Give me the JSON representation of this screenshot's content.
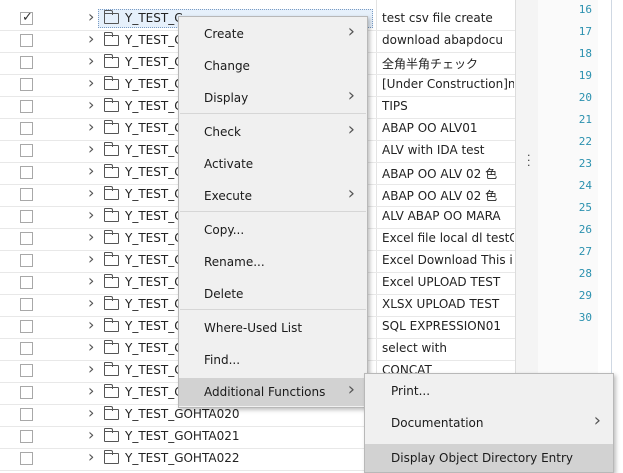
{
  "tree": {
    "rows": [
      {
        "name": "Y_TEST_C",
        "desc": "test csv file create",
        "checked": true
      },
      {
        "name": "Y_TEST_C",
        "desc": "download abapdocu",
        "checked": false
      },
      {
        "name": "Y_TEST_C",
        "desc": "全角半角チェック",
        "checked": false
      },
      {
        "name": "Y_TEST_C",
        "desc": "[Under Construction]n",
        "checked": false
      },
      {
        "name": "Y_TEST_C",
        "desc": "TIPS",
        "checked": false
      },
      {
        "name": "Y_TEST_C",
        "desc": "ABAP OO ALV01",
        "checked": false
      },
      {
        "name": "Y_TEST_C",
        "desc": "ALV with IDA test",
        "checked": false
      },
      {
        "name": "Y_TEST_C",
        "desc": "ABAP OO ALV 02 色",
        "checked": false
      },
      {
        "name": "Y_TEST_C",
        "desc": "ABAP OO ALV 02 色",
        "checked": false
      },
      {
        "name": "Y_TEST_C",
        "desc": "ALV ABAP OO MARA",
        "checked": false
      },
      {
        "name": "Y_TEST_C",
        "desc": "Excel file local dl testC",
        "checked": false
      },
      {
        "name": "Y_TEST_C",
        "desc": "Excel Download  This i",
        "checked": false
      },
      {
        "name": "Y_TEST_C",
        "desc": "Excel UPLOAD TEST",
        "checked": false
      },
      {
        "name": "Y_TEST_C",
        "desc": "XLSX UPLOAD TEST",
        "checked": false
      },
      {
        "name": "Y_TEST_C",
        "desc": "SQL EXPRESSION01",
        "checked": false
      },
      {
        "name": "Y_TEST_C",
        "desc": "select with",
        "checked": false
      },
      {
        "name": "Y_TEST_C",
        "desc": "CONCAT",
        "checked": false
      },
      {
        "name": "Y_TEST_C",
        "desc": "",
        "checked": false
      },
      {
        "name": "Y_TEST_GOHTA020",
        "desc": "",
        "checked": false
      },
      {
        "name": "Y_TEST_GOHTA021",
        "desc": "",
        "checked": false
      },
      {
        "name": "Y_TEST_GOHTA022",
        "desc": "",
        "checked": false
      }
    ]
  },
  "editor": {
    "line_numbers": [
      "16",
      "17",
      "18",
      "19",
      "20",
      "21",
      "22",
      "23",
      "24",
      "25",
      "26",
      "27",
      "28",
      "29",
      "30"
    ]
  },
  "context_menu": {
    "items": [
      {
        "label": "Create",
        "submenu": true
      },
      {
        "label": "Change",
        "submenu": false
      },
      {
        "label": "Display",
        "submenu": true
      },
      {
        "label": "Check",
        "submenu": true
      },
      {
        "label": "Activate",
        "submenu": false
      },
      {
        "label": "Execute",
        "submenu": true
      },
      {
        "label": "Copy...",
        "submenu": false
      },
      {
        "label": "Rename...",
        "submenu": false
      },
      {
        "label": "Delete",
        "submenu": false
      },
      {
        "label": "Where-Used List",
        "submenu": false
      },
      {
        "label": "Find...",
        "submenu": false
      },
      {
        "label": "Additional Functions",
        "submenu": true,
        "highlighted": true
      }
    ]
  },
  "submenu": {
    "items": [
      {
        "label": "Print...",
        "submenu": false
      },
      {
        "label": "Documentation",
        "submenu": true
      },
      {
        "label": "Display Object Directory Entry",
        "submenu": false,
        "highlighted": true
      }
    ]
  },
  "icons": {
    "chevron": "chevron-right-icon",
    "folder": "folder-icon",
    "check": "checkmark-icon"
  }
}
